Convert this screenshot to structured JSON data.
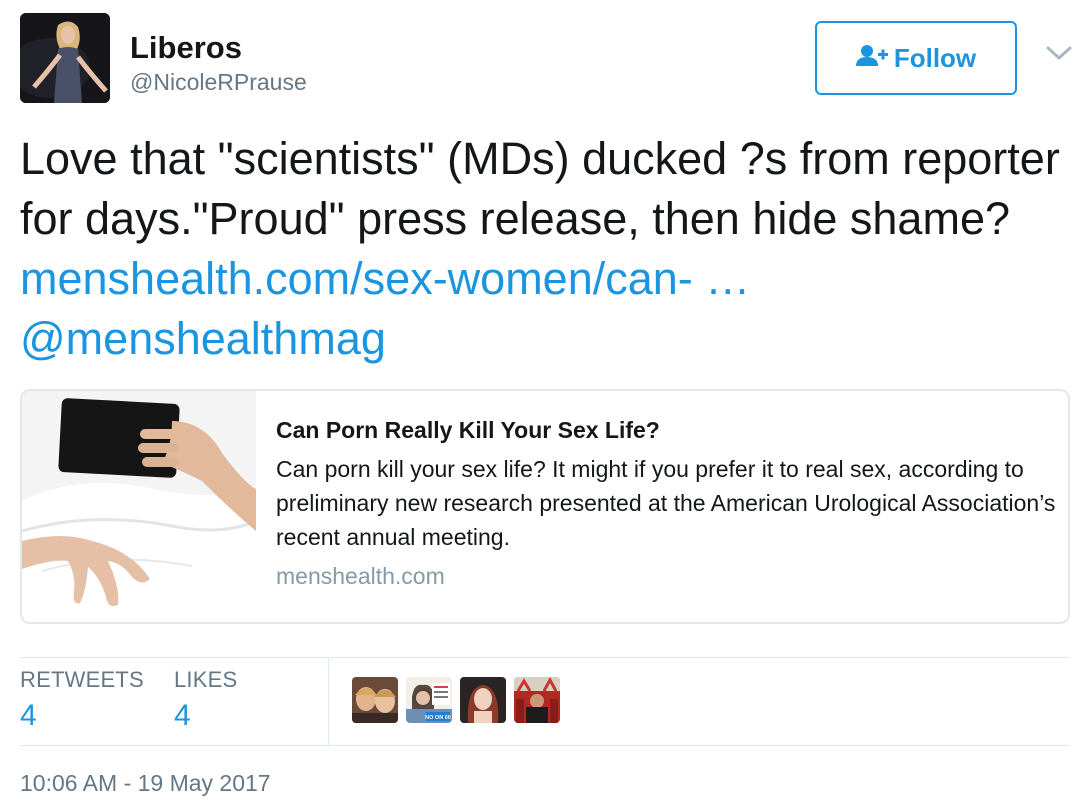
{
  "user": {
    "display_name": "Liberos",
    "handle": "@NicoleRPrause"
  },
  "follow_button": {
    "label": "Follow"
  },
  "tweet": {
    "text": "Love that \"scientists\" (MDs) ducked ?s from reporter for days.\"Proud\" press release, then hide shame?",
    "link": "menshealth.com/sex-women/can- …",
    "mention": "@menshealthmag"
  },
  "card": {
    "title": "Can Porn Really Kill Your Sex Life?",
    "description": "Can porn kill your sex life? It might if you prefer it to real sex, according to preliminary new research presented at the American Urological Association’s recent annual meeting.",
    "domain": "menshealth.com"
  },
  "stats": {
    "retweets_label": "RETWEETS",
    "retweets_count": "4",
    "likes_label": "LIKES",
    "likes_count": "4"
  },
  "liker_avatar_badge": "NO ON 60",
  "timestamp": "10:06 AM - 19 May 2017",
  "colors": {
    "link": "#1b95e0",
    "text": "#14171a",
    "muted": "#657786",
    "border": "#e1e8ed"
  }
}
